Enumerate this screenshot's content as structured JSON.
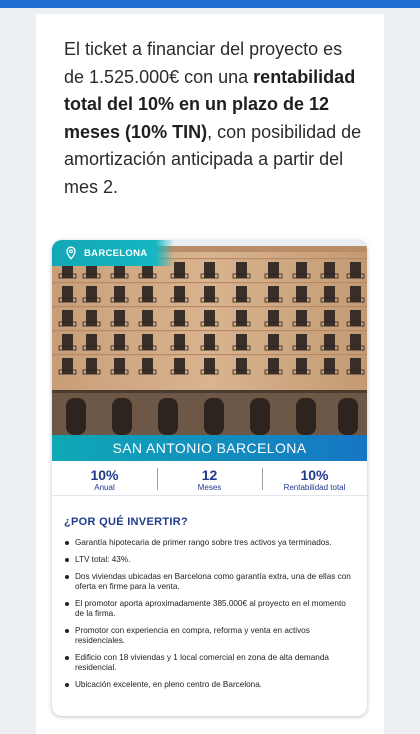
{
  "intro": {
    "part1": "El ticket a financiar del proyecto es de 1.525.000€ con una ",
    "bold1": "rentabilidad total del 10% en un plazo de 12 meses (10% TIN)",
    "part2": ", con posibilidad de amortización anticipada a partir del mes 2."
  },
  "project": {
    "location": "BARCELONA",
    "name": "SAN ANTONIO BARCELONA",
    "stats": [
      {
        "value": "10%",
        "label": "Anual"
      },
      {
        "value": "12",
        "label": "Meses"
      },
      {
        "value": "10%",
        "label": "Rentabilidad total"
      }
    ]
  },
  "why": {
    "title": "¿POR QUÉ INVERTIR?",
    "items": [
      "Garantía hipotecaria de primer rango sobre tres activos ya terminados.",
      "LTV total: 43%.",
      "Dos viviendas ubicadas en Barcelona como garantía extra, una de ellas con oferta en firme para la venta.",
      "El promotor aporta aproximadamente 385.000€ al proyecto en el momento de la firma.",
      "Promotor con experiencia en compra, reforma y venta en activos residenciales.",
      "Edificio con 18 viviendas y 1 local comercial en zona de alta demanda residencial.",
      "Ubicación excelente, en pleno centro de Barcelona."
    ]
  },
  "colors": {
    "accent_blue": "#1f3a8a",
    "teal": "#13a7b5",
    "top_strip": "#1e6fd0"
  },
  "icons": {
    "location": "map-pin-icon"
  }
}
